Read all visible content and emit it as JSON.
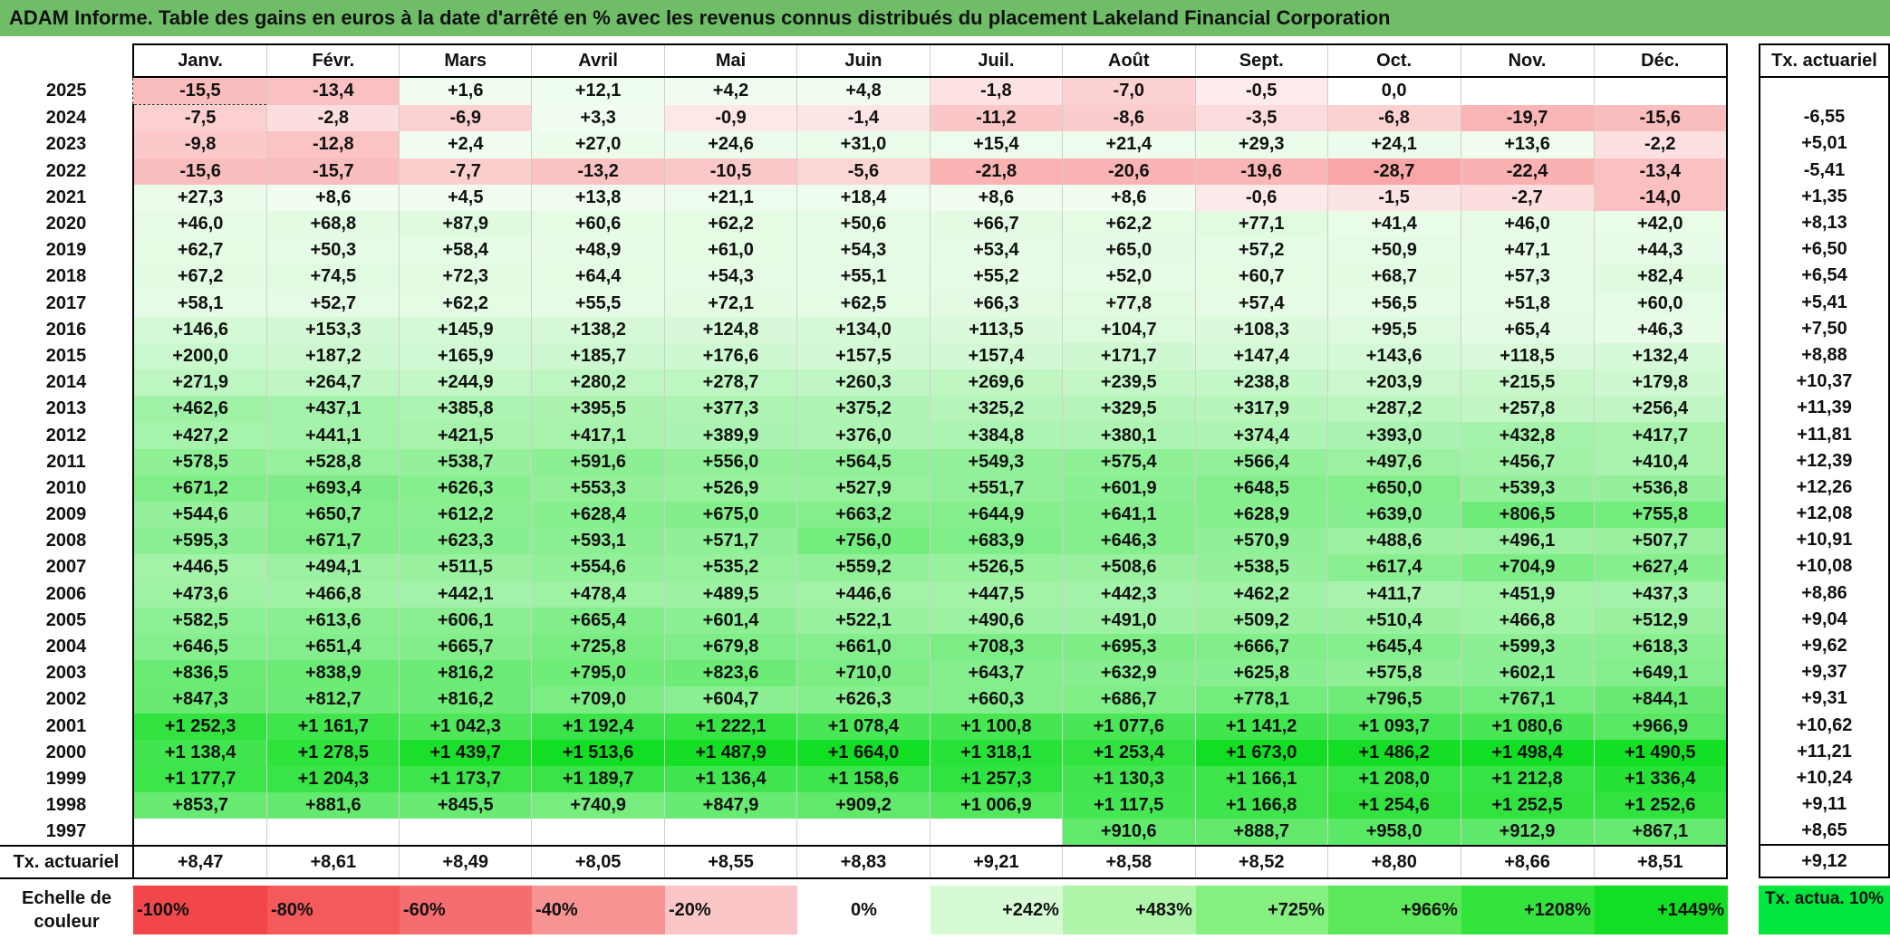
{
  "title": "ADAM Informe. Table des gains en euros à la date d'arrêté en % avec les revenus connus distribués du placement Lakeland Financial Corporation",
  "chart_data": {
    "type": "table",
    "months": [
      "Janv.",
      "Févr.",
      "Mars",
      "Avril",
      "Mai",
      "Juin",
      "Juil.",
      "Août",
      "Sept.",
      "Oct.",
      "Nov.",
      "Déc."
    ],
    "side_header": "Tx. actuariel",
    "rows": [
      {
        "year": "2025",
        "values": [
          "-15,5",
          "-13,4",
          "+1,6",
          "+12,1",
          "+4,2",
          "+4,8",
          "-1,8",
          "-7,0",
          "-0,5",
          "0,0",
          "",
          ""
        ],
        "rate": ""
      },
      {
        "year": "2024",
        "values": [
          "-7,5",
          "-2,8",
          "-6,9",
          "+3,3",
          "-0,9",
          "-1,4",
          "-11,2",
          "-8,6",
          "-3,5",
          "-6,8",
          "-19,7",
          "-15,6"
        ],
        "rate": "-6,55"
      },
      {
        "year": "2023",
        "values": [
          "-9,8",
          "-12,8",
          "+2,4",
          "+27,0",
          "+24,6",
          "+31,0",
          "+15,4",
          "+21,4",
          "+29,3",
          "+24,1",
          "+13,6",
          "-2,2"
        ],
        "rate": "+5,01"
      },
      {
        "year": "2022",
        "values": [
          "-15,6",
          "-15,7",
          "-7,7",
          "-13,2",
          "-10,5",
          "-5,6",
          "-21,8",
          "-20,6",
          "-19,6",
          "-28,7",
          "-22,4",
          "-13,4"
        ],
        "rate": "-5,41"
      },
      {
        "year": "2021",
        "values": [
          "+27,3",
          "+8,6",
          "+4,5",
          "+13,8",
          "+21,1",
          "+18,4",
          "+8,6",
          "+8,6",
          "-0,6",
          "-1,5",
          "-2,7",
          "-14,0"
        ],
        "rate": "+1,35"
      },
      {
        "year": "2020",
        "values": [
          "+46,0",
          "+68,8",
          "+87,9",
          "+60,6",
          "+62,2",
          "+50,6",
          "+66,7",
          "+62,2",
          "+77,1",
          "+41,4",
          "+46,0",
          "+42,0"
        ],
        "rate": "+8,13"
      },
      {
        "year": "2019",
        "values": [
          "+62,7",
          "+50,3",
          "+58,4",
          "+48,9",
          "+61,0",
          "+54,3",
          "+53,4",
          "+65,0",
          "+57,2",
          "+50,9",
          "+47,1",
          "+44,3"
        ],
        "rate": "+6,50"
      },
      {
        "year": "2018",
        "values": [
          "+67,2",
          "+74,5",
          "+72,3",
          "+64,4",
          "+54,3",
          "+55,1",
          "+55,2",
          "+52,0",
          "+60,7",
          "+68,7",
          "+57,3",
          "+82,4"
        ],
        "rate": "+6,54"
      },
      {
        "year": "2017",
        "values": [
          "+58,1",
          "+52,7",
          "+62,2",
          "+55,5",
          "+72,1",
          "+62,5",
          "+66,3",
          "+77,8",
          "+57,4",
          "+56,5",
          "+51,8",
          "+60,0"
        ],
        "rate": "+5,41"
      },
      {
        "year": "2016",
        "values": [
          "+146,6",
          "+153,3",
          "+145,9",
          "+138,2",
          "+124,8",
          "+134,0",
          "+113,5",
          "+104,7",
          "+108,3",
          "+95,5",
          "+65,4",
          "+46,3"
        ],
        "rate": "+7,50"
      },
      {
        "year": "2015",
        "values": [
          "+200,0",
          "+187,2",
          "+165,9",
          "+185,7",
          "+176,6",
          "+157,5",
          "+157,4",
          "+171,7",
          "+147,4",
          "+143,6",
          "+118,5",
          "+132,4"
        ],
        "rate": "+8,88"
      },
      {
        "year": "2014",
        "values": [
          "+271,9",
          "+264,7",
          "+244,9",
          "+280,2",
          "+278,7",
          "+260,3",
          "+269,6",
          "+239,5",
          "+238,8",
          "+203,9",
          "+215,5",
          "+179,8"
        ],
        "rate": "+10,37"
      },
      {
        "year": "2013",
        "values": [
          "+462,6",
          "+437,1",
          "+385,8",
          "+395,5",
          "+377,3",
          "+375,2",
          "+325,2",
          "+329,5",
          "+317,9",
          "+287,2",
          "+257,8",
          "+256,4"
        ],
        "rate": "+11,39"
      },
      {
        "year": "2012",
        "values": [
          "+427,2",
          "+441,1",
          "+421,5",
          "+417,1",
          "+389,9",
          "+376,0",
          "+384,8",
          "+380,1",
          "+374,4",
          "+393,0",
          "+432,8",
          "+417,7"
        ],
        "rate": "+11,81"
      },
      {
        "year": "2011",
        "values": [
          "+578,5",
          "+528,8",
          "+538,7",
          "+591,6",
          "+556,0",
          "+564,5",
          "+549,3",
          "+575,4",
          "+566,4",
          "+497,6",
          "+456,7",
          "+410,4"
        ],
        "rate": "+12,39"
      },
      {
        "year": "2010",
        "values": [
          "+671,2",
          "+693,4",
          "+626,3",
          "+553,3",
          "+526,9",
          "+527,9",
          "+551,7",
          "+601,9",
          "+648,5",
          "+650,0",
          "+539,3",
          "+536,8"
        ],
        "rate": "+12,26"
      },
      {
        "year": "2009",
        "values": [
          "+544,6",
          "+650,7",
          "+612,2",
          "+628,4",
          "+675,0",
          "+663,2",
          "+644,9",
          "+641,1",
          "+628,9",
          "+639,0",
          "+806,5",
          "+755,8"
        ],
        "rate": "+12,08"
      },
      {
        "year": "2008",
        "values": [
          "+595,3",
          "+671,7",
          "+623,3",
          "+593,1",
          "+571,7",
          "+756,0",
          "+683,9",
          "+646,3",
          "+570,9",
          "+488,6",
          "+496,1",
          "+507,7"
        ],
        "rate": "+10,91"
      },
      {
        "year": "2007",
        "values": [
          "+446,5",
          "+494,1",
          "+511,5",
          "+554,6",
          "+535,2",
          "+559,2",
          "+526,5",
          "+508,6",
          "+538,5",
          "+617,4",
          "+704,9",
          "+627,4"
        ],
        "rate": "+10,08"
      },
      {
        "year": "2006",
        "values": [
          "+473,6",
          "+466,8",
          "+442,1",
          "+478,4",
          "+489,5",
          "+446,6",
          "+447,5",
          "+442,3",
          "+462,2",
          "+411,7",
          "+451,9",
          "+437,3"
        ],
        "rate": "+8,86"
      },
      {
        "year": "2005",
        "values": [
          "+582,5",
          "+613,6",
          "+606,1",
          "+665,4",
          "+601,4",
          "+522,1",
          "+490,6",
          "+491,0",
          "+509,2",
          "+510,4",
          "+466,8",
          "+512,9"
        ],
        "rate": "+9,04"
      },
      {
        "year": "2004",
        "values": [
          "+646,5",
          "+651,4",
          "+665,7",
          "+725,8",
          "+679,8",
          "+661,0",
          "+708,3",
          "+695,3",
          "+666,7",
          "+645,4",
          "+599,3",
          "+618,3"
        ],
        "rate": "+9,62"
      },
      {
        "year": "2003",
        "values": [
          "+836,5",
          "+838,9",
          "+816,2",
          "+795,0",
          "+823,6",
          "+710,0",
          "+643,7",
          "+632,9",
          "+625,8",
          "+575,8",
          "+602,1",
          "+649,1"
        ],
        "rate": "+9,37"
      },
      {
        "year": "2002",
        "values": [
          "+847,3",
          "+812,7",
          "+816,2",
          "+709,0",
          "+604,7",
          "+626,3",
          "+660,3",
          "+686,7",
          "+778,1",
          "+796,5",
          "+767,1",
          "+844,1"
        ],
        "rate": "+9,31"
      },
      {
        "year": "2001",
        "values": [
          "+1 252,3",
          "+1 161,7",
          "+1 042,3",
          "+1 192,4",
          "+1 222,1",
          "+1 078,4",
          "+1 100,8",
          "+1 077,6",
          "+1 141,2",
          "+1 093,7",
          "+1 080,6",
          "+966,9"
        ],
        "rate": "+10,62"
      },
      {
        "year": "2000",
        "values": [
          "+1 138,4",
          "+1 278,5",
          "+1 439,7",
          "+1 513,6",
          "+1 487,9",
          "+1 664,0",
          "+1 318,1",
          "+1 253,4",
          "+1 673,0",
          "+1 486,2",
          "+1 498,4",
          "+1 490,5"
        ],
        "rate": "+11,21"
      },
      {
        "year": "1999",
        "values": [
          "+1 177,7",
          "+1 204,3",
          "+1 173,7",
          "+1 189,7",
          "+1 136,4",
          "+1 158,6",
          "+1 257,3",
          "+1 130,3",
          "+1 166,1",
          "+1 208,0",
          "+1 212,8",
          "+1 336,4"
        ],
        "rate": "+10,24"
      },
      {
        "year": "1998",
        "values": [
          "+853,7",
          "+881,6",
          "+845,5",
          "+740,9",
          "+847,9",
          "+909,2",
          "+1 006,9",
          "+1 117,5",
          "+1 166,8",
          "+1 254,6",
          "+1 252,5",
          "+1 252,6"
        ],
        "rate": "+9,11"
      },
      {
        "year": "1997",
        "values": [
          "",
          "",
          "",
          "",
          "",
          "",
          "",
          "+910,6",
          "+888,7",
          "+958,0",
          "+912,9",
          "+867,1"
        ],
        "rate": "+8,65"
      }
    ],
    "footer_label": "Tx. actuariel",
    "footer_values": [
      "+8,47",
      "+8,61",
      "+8,49",
      "+8,05",
      "+8,55",
      "+8,83",
      "+9,21",
      "+8,58",
      "+8,52",
      "+8,80",
      "+8,66",
      "+8,51"
    ],
    "footer_rate": "+9,12",
    "scale_label": "Echelle de couleur",
    "scale": [
      {
        "label": "-100%",
        "color": "#f2474a",
        "align": "left"
      },
      {
        "label": "-80%",
        "color": "#f45a5c",
        "align": "left"
      },
      {
        "label": "-60%",
        "color": "#f66d6f",
        "align": "left"
      },
      {
        "label": "-40%",
        "color": "#f89394",
        "align": "left"
      },
      {
        "label": "-20%",
        "color": "#fbc6c7",
        "align": "left"
      },
      {
        "label": "0%",
        "color": "#ffffff",
        "align": "center"
      },
      {
        "label": "+242%",
        "color": "#d6fbd4",
        "align": "right"
      },
      {
        "label": "+483%",
        "color": "#aef5a9",
        "align": "right"
      },
      {
        "label": "+725%",
        "color": "#85ef80",
        "align": "right"
      },
      {
        "label": "+966%",
        "color": "#5ce959",
        "align": "right"
      },
      {
        "label": "+1208%",
        "color": "#33e43d",
        "align": "right"
      },
      {
        "label": "+1449%",
        "color": "#12df23",
        "align": "right"
      }
    ],
    "scale_side_label": "Tx. actua. 10%",
    "scale_side_color": "#00e63c"
  }
}
